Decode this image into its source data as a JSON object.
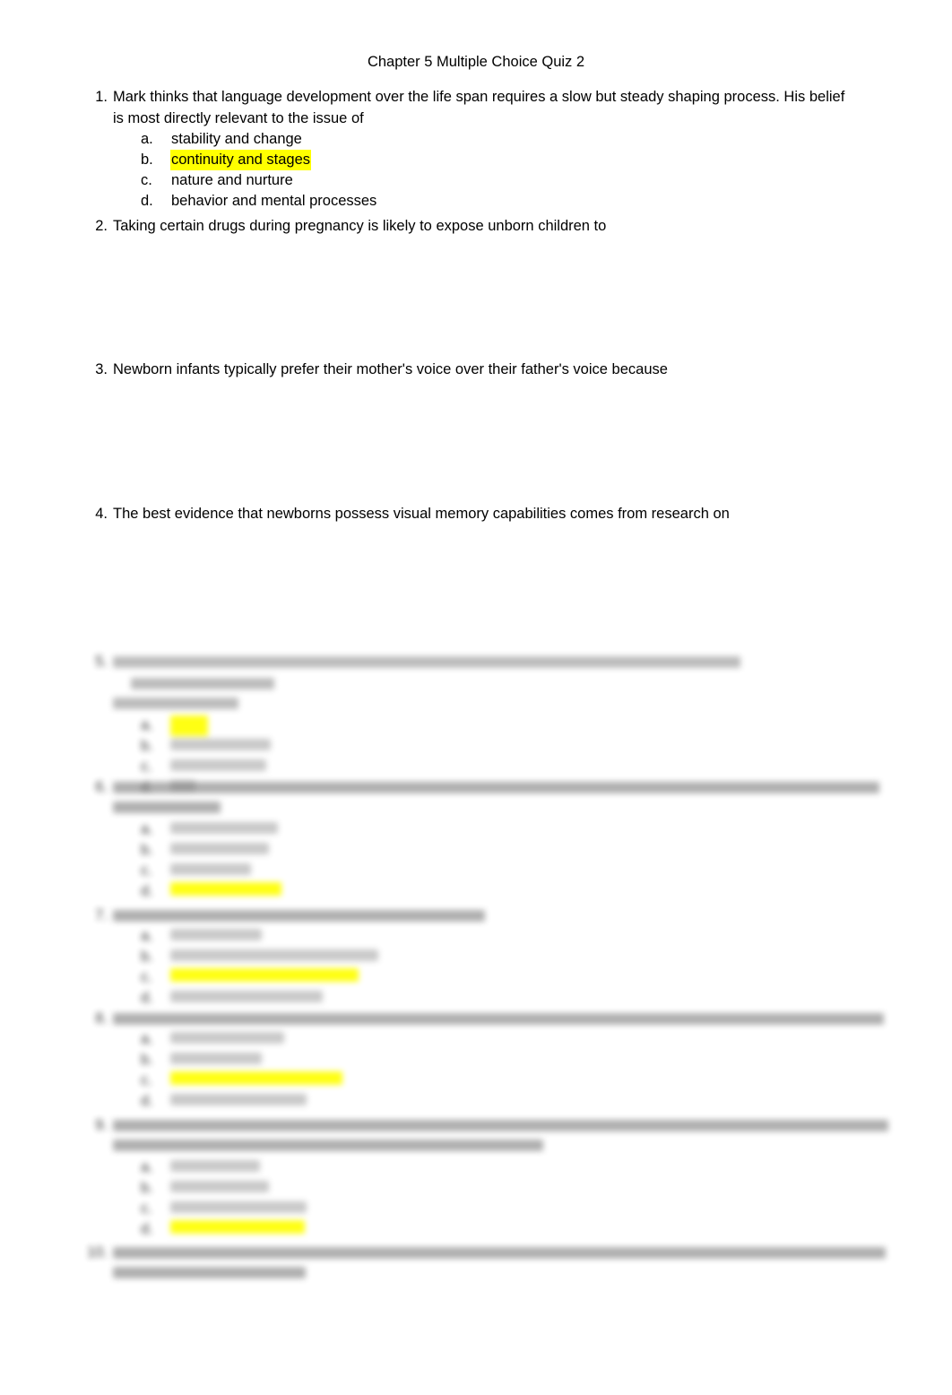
{
  "document": {
    "title": "Chapter 5 Multiple Choice Quiz 2",
    "page_background": "#ffffff",
    "text_color": "#000000",
    "highlight_color": "#ffff00"
  },
  "questions": [
    {
      "number": "1.",
      "stem_line1": "Mark thinks that language development over the life span requires a slow but steady shaping process. His belief",
      "stem_line2": "is most directly relevant to the issue of",
      "legible": true,
      "options": [
        {
          "letter": "a.",
          "text": "stability and change",
          "highlighted": false
        },
        {
          "letter": "b.",
          "text": "continuity and stages",
          "highlighted": true
        },
        {
          "letter": "c.",
          "text": "nature and nurture",
          "highlighted": false
        },
        {
          "letter": "d.",
          "text": "behavior and mental processes",
          "highlighted": false
        }
      ]
    },
    {
      "number": "2.",
      "stem_line1": "Taking certain drugs during pregnancy is likely to expose unborn children to",
      "stem_line2": "",
      "legible": true,
      "options": []
    },
    {
      "number": "3.",
      "stem_line1": "Newborn infants typically prefer their mother's voice over their father's voice because",
      "stem_line2": "",
      "legible": true,
      "options": []
    },
    {
      "number": "4.",
      "stem_line1": "The best evidence that newborns possess visual memory capabilities comes from research on",
      "stem_line2": "",
      "legible": true,
      "options": []
    },
    {
      "number": "5.",
      "stem_line1": "",
      "stem_line2": "",
      "legible": false,
      "options": [
        {
          "letter": "a.",
          "text": "",
          "highlighted": true
        },
        {
          "letter": "b.",
          "text": "",
          "highlighted": false
        },
        {
          "letter": "c.",
          "text": "",
          "highlighted": false
        },
        {
          "letter": "d.",
          "text": "",
          "highlighted": false
        }
      ]
    },
    {
      "number": "6.",
      "stem_line1": "",
      "stem_line2": "",
      "legible": false,
      "options": [
        {
          "letter": "a.",
          "text": "",
          "highlighted": false
        },
        {
          "letter": "b.",
          "text": "",
          "highlighted": false
        },
        {
          "letter": "c.",
          "text": "",
          "highlighted": false
        },
        {
          "letter": "d.",
          "text": "",
          "highlighted": true
        }
      ]
    },
    {
      "number": "7.",
      "stem_line1": "",
      "stem_line2": "",
      "legible": false,
      "options": [
        {
          "letter": "a.",
          "text": "",
          "highlighted": false
        },
        {
          "letter": "b.",
          "text": "",
          "highlighted": false
        },
        {
          "letter": "c.",
          "text": "",
          "highlighted": true
        },
        {
          "letter": "d.",
          "text": "",
          "highlighted": false
        }
      ]
    },
    {
      "number": "8.",
      "stem_line1": "",
      "stem_line2": "",
      "legible": false,
      "options": [
        {
          "letter": "a.",
          "text": "",
          "highlighted": false
        },
        {
          "letter": "b.",
          "text": "",
          "highlighted": false
        },
        {
          "letter": "c.",
          "text": "",
          "highlighted": true
        },
        {
          "letter": "d.",
          "text": "",
          "highlighted": false
        }
      ]
    },
    {
      "number": "9.",
      "stem_line1": "",
      "stem_line2": "",
      "legible": false,
      "options": [
        {
          "letter": "a.",
          "text": "",
          "highlighted": false
        },
        {
          "letter": "b.",
          "text": "",
          "highlighted": false
        },
        {
          "letter": "c.",
          "text": "",
          "highlighted": false
        },
        {
          "letter": "d.",
          "text": "",
          "highlighted": true
        }
      ]
    },
    {
      "number": "10.",
      "stem_line1": "",
      "stem_line2": "",
      "legible": false,
      "options": []
    }
  ],
  "blurred_placeholder_bars": {
    "note": "Lower portion of page is out of focus; text shapes are unreadable.",
    "q5": {
      "stem": [
        760,
        300
      ],
      "opts": [
        100,
        165,
        160,
        40
      ]
    },
    "q6": {
      "stem": [
        880,
        200
      ],
      "opts": [
        150,
        135,
        130,
        200
      ]
    },
    "q7": {
      "stem": [
        430,
        0
      ],
      "opts": [
        105,
        240,
        215,
        175
      ]
    },
    "q8": {
      "stem": [
        885,
        0
      ],
      "opts": [
        130,
        105,
        195,
        155
      ]
    },
    "q9": {
      "stem": [
        890,
        490
      ],
      "opts": [
        100,
        110,
        155,
        150
      ]
    },
    "q10": {
      "stem": [
        890,
        245
      ],
      "opts": []
    }
  }
}
